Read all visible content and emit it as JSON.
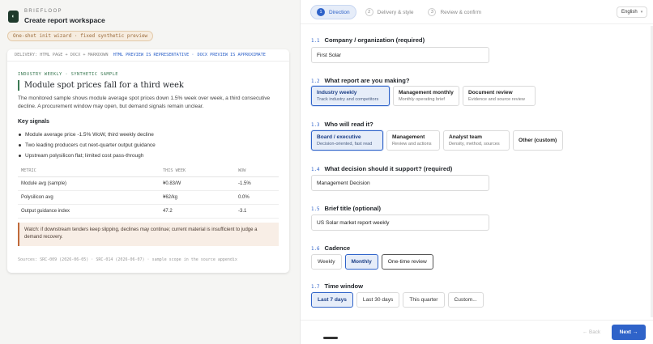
{
  "app": {
    "brand": "BRIEFLOOP",
    "title": "Create report workspace",
    "logo_glyph": "◐",
    "badge": "One-shot init wizard · fixed synthetic preview"
  },
  "preview": {
    "delivery": "DELIVERY: HTML PAGE + DOCX + MARKDOWN",
    "html_note": "HTML PREVIEW IS REPRESENTATIVE ·",
    "docx_note": "DOCX PREVIEW IS APPROXIMATE",
    "eyebrow": "INDUSTRY WEEKLY · SYNTHETIC SAMPLE",
    "headline": "Module spot prices fall for a third week",
    "summary": "The monitored sample shows module average spot prices down 1.5% week over week, a third consecutive decline. A procurement window may open, but demand signals remain unclear.",
    "signals_heading": "Key signals",
    "signals": [
      "Module average price -1.5% WoW, third weekly decline",
      "Two leading producers cut next-quarter output guidance",
      "Upstream polysilicon flat; limited cost pass-through"
    ],
    "table": {
      "headers": [
        "METRIC",
        "THIS WEEK",
        "WOW"
      ],
      "rows": [
        [
          "Module avg (sample)",
          "¥0.83/W",
          "-1.5%"
        ],
        [
          "Polysilicon avg",
          "¥62/kg",
          "0.0%"
        ],
        [
          "Output guidance index",
          "47.2",
          "-3.1"
        ]
      ]
    },
    "watch": "Watch: if downstream tenders keep slipping, declines may continue; current material is insufficient to judge a demand recovery.",
    "sources": "Sources: SRC-009 (2026-06-05) · SRC-014 (2026-06-07) · sample scope in the source appendix"
  },
  "wizard": {
    "steps": [
      {
        "num": "1",
        "label": "Direction"
      },
      {
        "num": "2",
        "label": "Delivery & style"
      },
      {
        "num": "3",
        "label": "Review & confirm"
      }
    ],
    "language": "English",
    "q1": {
      "num": "1.1",
      "label": "Company / organization (required)",
      "value": "First Solar"
    },
    "q2": {
      "num": "1.2",
      "label": "What report are you making?",
      "options": [
        {
          "title": "Industry weekly",
          "sub": "Track industry and competitors"
        },
        {
          "title": "Management monthly",
          "sub": "Monthly operating brief"
        },
        {
          "title": "Document review",
          "sub": "Evidence and source review"
        }
      ]
    },
    "q3": {
      "num": "1.3",
      "label": "Who will read it?",
      "options": [
        {
          "title": "Board / executive",
          "sub": "Decision-oriented, fast read"
        },
        {
          "title": "Management",
          "sub": "Review and actions"
        },
        {
          "title": "Analyst team",
          "sub": "Density, method, sources"
        },
        {
          "title": "Other (custom)",
          "sub": ""
        }
      ]
    },
    "q4": {
      "num": "1.4",
      "label": "What decision should it support? (required)",
      "value": "Management Decision"
    },
    "q5": {
      "num": "1.5",
      "label": "Brief title (optional)",
      "value": "US Solar market report weekly"
    },
    "q6": {
      "num": "1.6",
      "label": "Cadence",
      "options": [
        "Weekly",
        "Monthly",
        "One-time review"
      ]
    },
    "q7": {
      "num": "1.7",
      "label": "Time window",
      "options": [
        "Last 7 days",
        "Last 30 days",
        "This quarter",
        "Custom..."
      ]
    },
    "back": "← Back",
    "next": "Next →"
  },
  "colors": {
    "accent": "#2f63c9",
    "brand_green": "#3c7a54",
    "warning": "#c06a3a"
  }
}
